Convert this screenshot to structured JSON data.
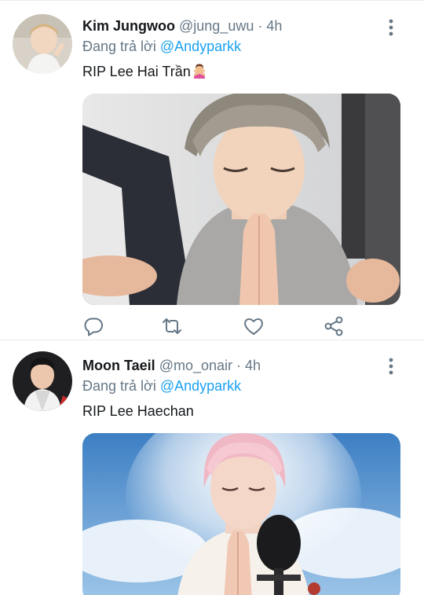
{
  "tweets": [
    {
      "name": "Kim Jungwoo",
      "handle": "@jung_uwu",
      "separator": "·",
      "time": "4h",
      "reply_prefix": "Đang trả lời",
      "reply_to": "@Andyparkk",
      "text": "RIP Lee Hai Trần",
      "emoji": "person-gesturing-no",
      "media_description": "photo-person-praying-hands",
      "actions": [
        "reply-icon",
        "retweet-icon",
        "like-icon",
        "share-icon"
      ]
    },
    {
      "name": "Moon Taeil",
      "handle": "@mo_onair",
      "separator": "·",
      "time": "4h",
      "reply_prefix": "Đang trả lời",
      "reply_to": "@Andyparkk",
      "text": "RIP Lee Haechan",
      "media_description": "photo-person-praying-with-halo-clouds"
    }
  ],
  "colors": {
    "primary_text": "#14171a",
    "secondary_text": "#657786",
    "link": "#1da1f2",
    "divider": "#e6ecf0",
    "icon": "#657786"
  }
}
